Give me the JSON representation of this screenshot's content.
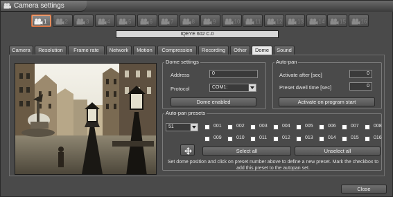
{
  "window": {
    "title": "Camera settings",
    "title_icon": "camera-icon"
  },
  "cameras": {
    "active": "1",
    "items": [
      {
        "num": "1"
      },
      {
        "num": "2"
      },
      {
        "num": "3"
      },
      {
        "num": "4"
      },
      {
        "num": "5"
      },
      {
        "num": "6"
      },
      {
        "num": "7"
      },
      {
        "num": "8"
      },
      {
        "num": "9"
      },
      {
        "num": "10"
      },
      {
        "num": "11"
      },
      {
        "num": "12"
      },
      {
        "num": "13"
      },
      {
        "num": "14"
      },
      {
        "num": "15"
      },
      {
        "num": "16"
      }
    ]
  },
  "device_name": "IQEYE 602 C.0",
  "tabs": [
    "Camera",
    "Resolution",
    "Frame rate",
    "Network",
    "Motion",
    "Compression",
    "Recording",
    "Other",
    "Dome",
    "Sound"
  ],
  "active_tab": "Dome",
  "dome_settings": {
    "title": "Dome settings",
    "address_label": "Address",
    "address_value": "0",
    "protocol_label": "Protocol",
    "protocol_value": "COM1:",
    "enabled_button": "Dome enabled"
  },
  "auto_pan": {
    "title": "Auto-pan",
    "activate_after_label": "Activate after [sec]",
    "activate_after_value": "0",
    "dwell_label": "Preset dwell time [sec]",
    "dwell_value": "0",
    "start_button": "Activate on program start"
  },
  "presets": {
    "title": "Auto-pan presets",
    "selected": "51",
    "numbers": [
      "001",
      "002",
      "003",
      "004",
      "005",
      "006",
      "007",
      "008",
      "009",
      "010",
      "011",
      "012",
      "013",
      "014",
      "015",
      "016"
    ],
    "select_all": "Select all",
    "unselect_all": "Unselect all",
    "hint": "Set dome position and click on preset number above to define a new preset. Mark the checkbox to add this preset to the autopan set.",
    "move_icon": "move-arrows-icon"
  },
  "close_button": "Close"
}
